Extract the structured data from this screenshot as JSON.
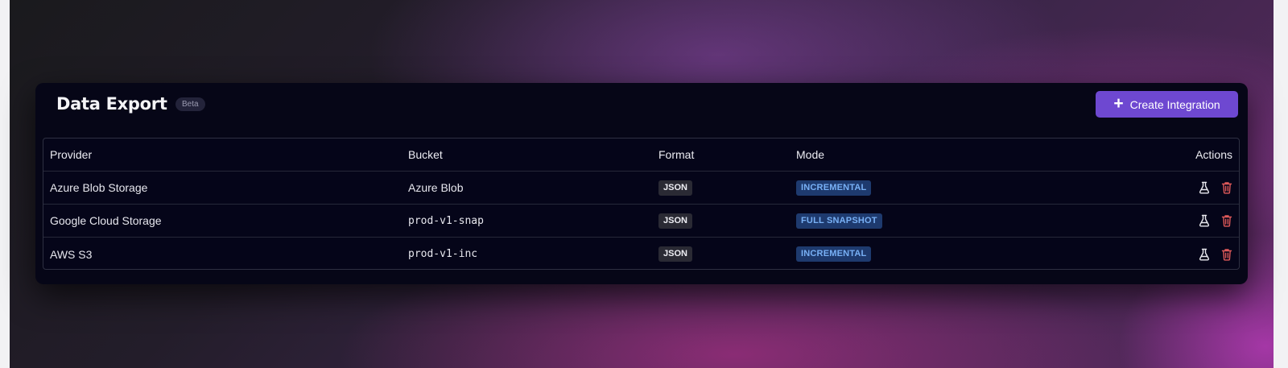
{
  "header": {
    "title": "Data Export",
    "badge": "Beta",
    "create_button_label": "Create Integration",
    "create_button_icon": "plus-icon"
  },
  "table": {
    "columns": {
      "provider": "Provider",
      "bucket": "Bucket",
      "format": "Format",
      "mode": "Mode",
      "actions": "Actions"
    },
    "rows": [
      {
        "provider": "Azure Blob Storage",
        "bucket": "Azure Blob",
        "format": "JSON",
        "mode": "INCREMENTAL"
      },
      {
        "provider": "Google Cloud Storage",
        "bucket": "prod-v1-snap",
        "format": "JSON",
        "mode": "FULL SNAPSHOT"
      },
      {
        "provider": "AWS S3",
        "bucket": "prod-v1-inc",
        "format": "JSON",
        "mode": "INCREMENTAL"
      }
    ],
    "row_actions": [
      "flask-icon",
      "trash-icon"
    ]
  },
  "colors": {
    "accent": "#6e48d1",
    "card_background": "#060617",
    "mode_badge_text": "#78b0f5",
    "mode_badge_background": "#1e3a6e",
    "delete_icon": "#e05a5a"
  }
}
